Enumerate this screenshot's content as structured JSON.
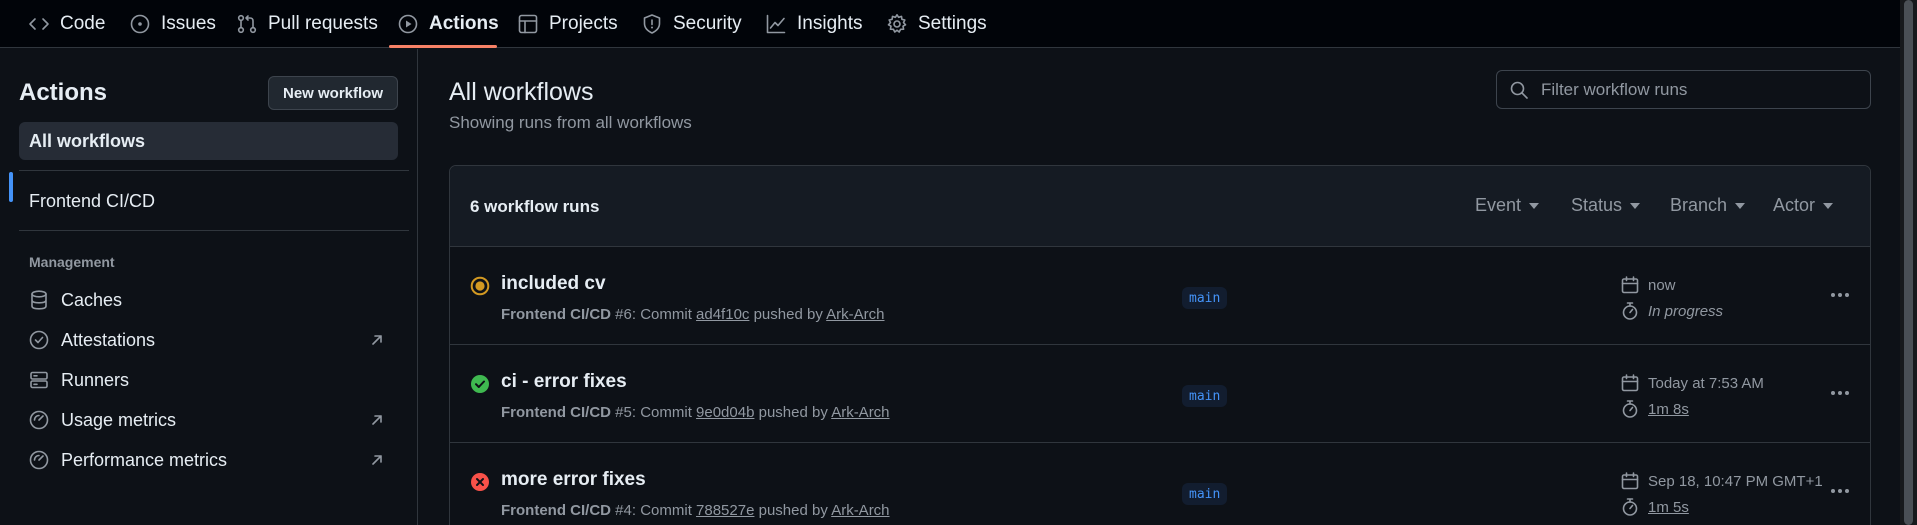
{
  "nav": {
    "tabs": [
      {
        "label": "Code",
        "icon": "code-icon"
      },
      {
        "label": "Issues",
        "icon": "issue-opened-icon"
      },
      {
        "label": "Pull requests",
        "icon": "git-pull-request-icon"
      },
      {
        "label": "Actions",
        "icon": "play-icon",
        "active": true
      },
      {
        "label": "Projects",
        "icon": "table-icon"
      },
      {
        "label": "Security",
        "icon": "shield-icon"
      },
      {
        "label": "Insights",
        "icon": "graph-icon"
      },
      {
        "label": "Settings",
        "icon": "gear-icon"
      }
    ],
    "active_underline_color": "#f78166"
  },
  "sidebar": {
    "title": "Actions",
    "new_workflow_label": "New workflow",
    "all_workflows_label": "All workflows",
    "workflows": [
      "Frontend CI/CD"
    ],
    "management_heading": "Management",
    "management_items": [
      {
        "label": "Caches",
        "icon": "database-icon",
        "external": false
      },
      {
        "label": "Attestations",
        "icon": "verified-icon",
        "external": true
      },
      {
        "label": "Runners",
        "icon": "server-icon",
        "external": false
      },
      {
        "label": "Usage metrics",
        "icon": "meter-icon",
        "external": true
      },
      {
        "label": "Performance metrics",
        "icon": "meter-icon",
        "external": true
      }
    ],
    "selected_indicator_color": "#4493f8"
  },
  "main": {
    "title": "All workflows",
    "subtitle": "Showing runs from all workflows",
    "filter_placeholder": "Filter workflow runs",
    "runs_count_label": "6 workflow runs",
    "filters": [
      "Event",
      "Status",
      "Branch",
      "Actor"
    ],
    "runs": [
      {
        "title": "included cv",
        "status": "in_progress",
        "workflow": "Frontend CI/CD",
        "run_label": "#6: Commit",
        "commit": "ad4f10c",
        "pushed_by": "pushed by",
        "author": "Ark-Arch",
        "branch": "main",
        "when": "now",
        "duration": "In progress"
      },
      {
        "title": "ci - error fixes",
        "status": "success",
        "workflow": "Frontend CI/CD",
        "run_label": "#5: Commit",
        "commit": "9e0d04b",
        "pushed_by": "pushed by",
        "author": "Ark-Arch",
        "branch": "main",
        "when": "Today at 7:53 AM",
        "duration": "1m 8s"
      },
      {
        "title": "more error fixes",
        "status": "failure",
        "workflow": "Frontend CI/CD",
        "run_label": "#4: Commit",
        "commit": "788527e",
        "pushed_by": "pushed by",
        "author": "Ark-Arch",
        "branch": "main",
        "when": "Sep 18, 10:47 PM GMT+1",
        "duration": "1m 5s"
      }
    ],
    "status_colors": {
      "in_progress": "#d29922",
      "success": "#3fb950",
      "failure": "#f85149"
    }
  }
}
